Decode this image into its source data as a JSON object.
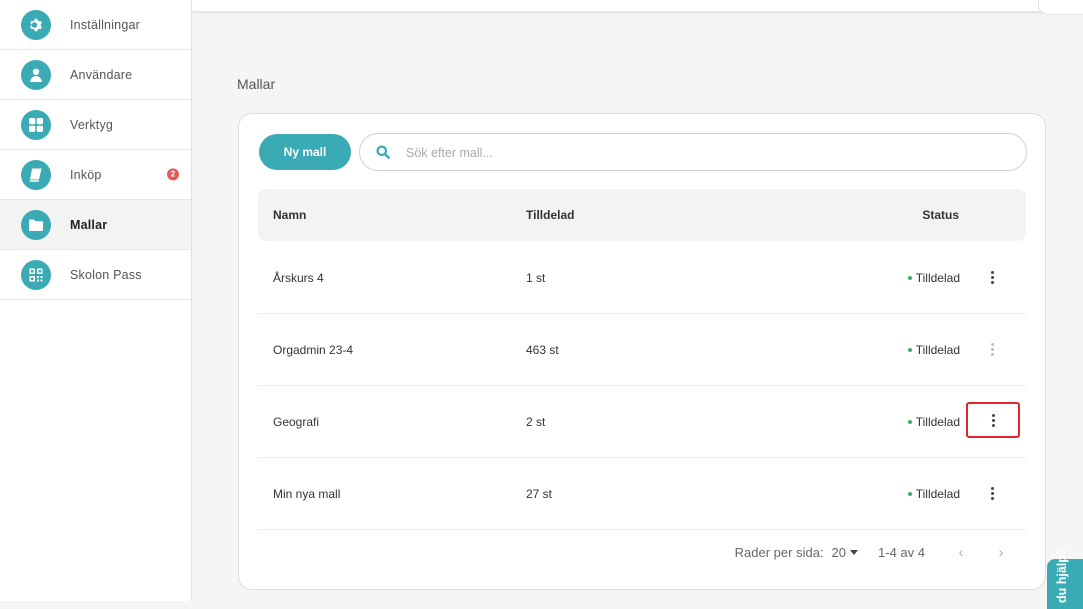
{
  "sidebar": {
    "items": [
      {
        "label": "Inställningar",
        "icon": "gear-icon"
      },
      {
        "label": "Användare",
        "icon": "user-icon"
      },
      {
        "label": "Verktyg",
        "icon": "grid-icon"
      },
      {
        "label": "Inköp",
        "icon": "book-icon",
        "badge": "2"
      },
      {
        "label": "Mallar",
        "icon": "folder-icon",
        "active": true
      },
      {
        "label": "Skolon Pass",
        "icon": "qr-icon"
      }
    ]
  },
  "page": {
    "title": "Mallar"
  },
  "toolbar": {
    "new_label": "Ny mall",
    "search_placeholder": "Sök efter mall..."
  },
  "table": {
    "headers": {
      "name": "Namn",
      "assigned": "Tilldelad",
      "status": "Status"
    },
    "rows": [
      {
        "name": "Årskurs 4",
        "assigned": "1 st",
        "status": "Tilldelad"
      },
      {
        "name": "Orgadmin 23-4",
        "assigned": "463 st",
        "status": "Tilldelad"
      },
      {
        "name": "Geografi",
        "assigned": "2 st",
        "status": "Tilldelad"
      },
      {
        "name": "Min nya mall",
        "assigned": "27 st",
        "status": "Tilldelad"
      }
    ]
  },
  "pagination": {
    "rows_per_page_label": "Rader per sida:",
    "rows_per_page_value": "20",
    "range": "1-4 av 4",
    "prev": "‹",
    "next": "›"
  },
  "help_tab": {
    "label": "du hjälp?"
  },
  "colors": {
    "accent": "#3aaab5",
    "badge": "#e05a5a",
    "status_dot": "#3fae6b",
    "highlight": "#e0262b"
  }
}
